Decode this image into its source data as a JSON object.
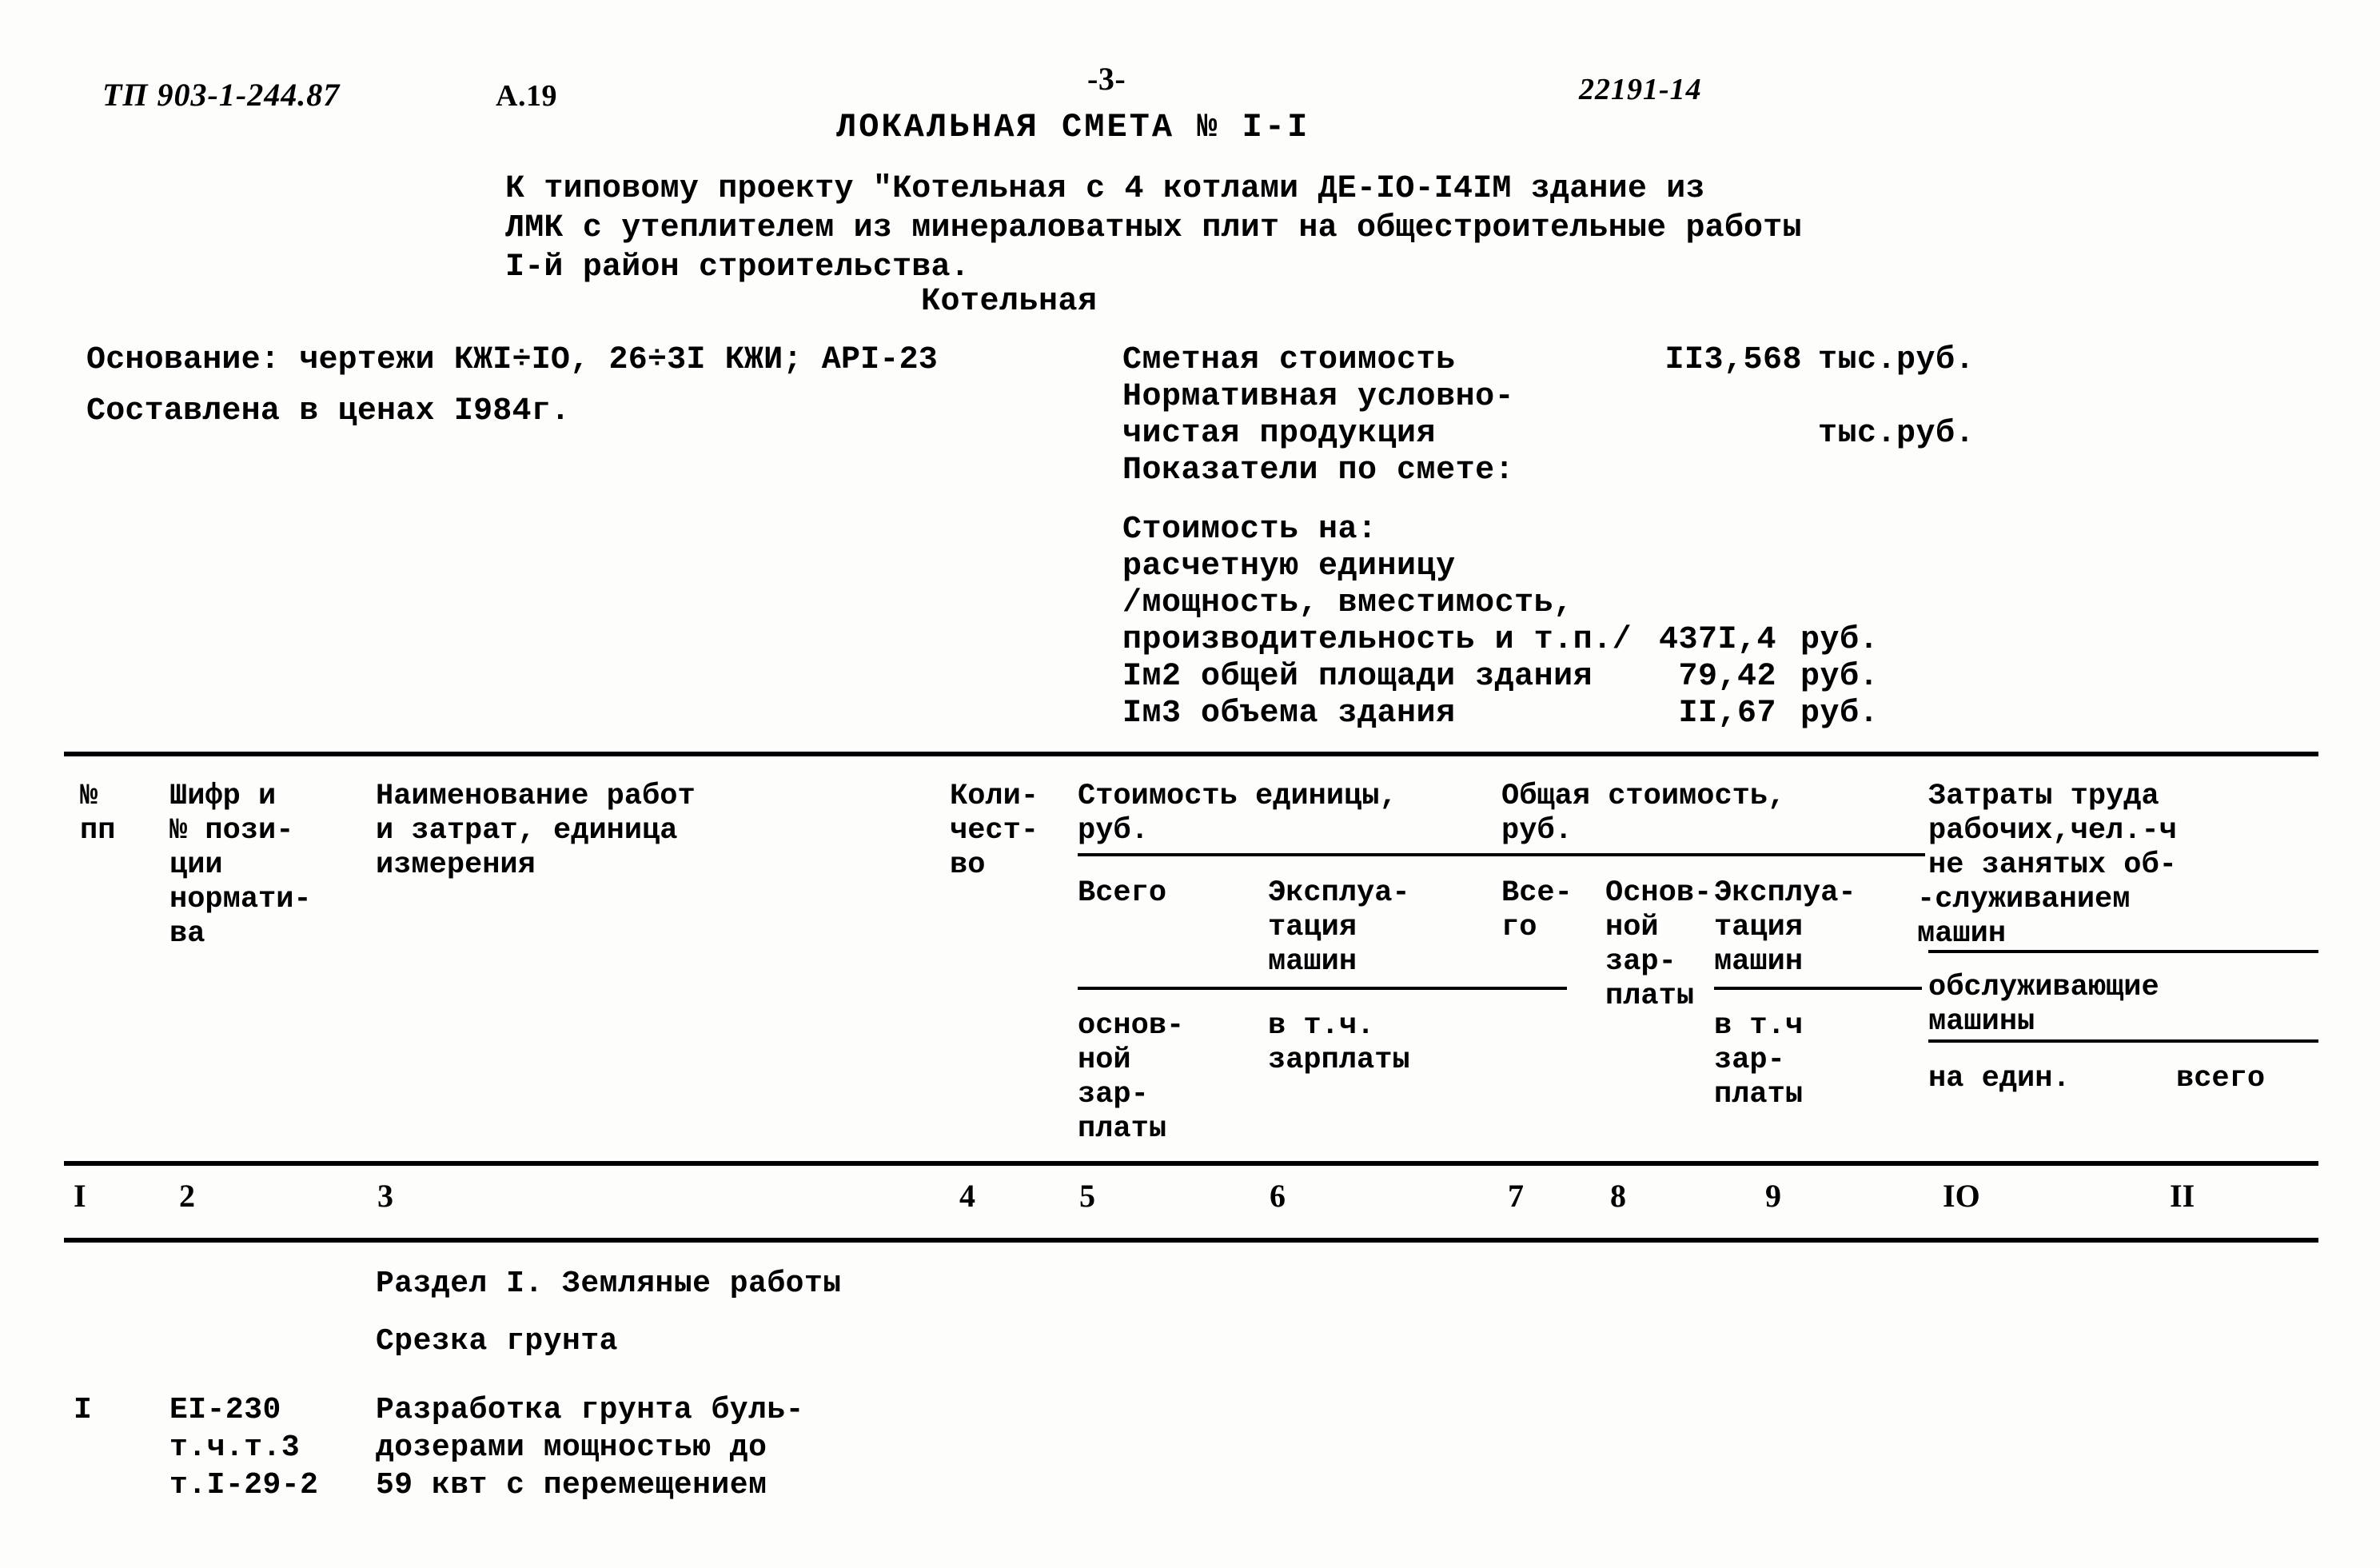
{
  "header": {
    "doc_code": "ТП 903-1-244.87",
    "sheet_code": "А.19",
    "page_number": "-3-",
    "archive_code": "22191-14",
    "title": "ЛОКАЛЬНАЯ СМЕТА № I-I"
  },
  "project": {
    "description_line1": "К типовому проекту \"Котельная с 4 котлами ДЕ-IO-I4IM здание из",
    "description_line2": "ЛМК с утеплителем из минераловатных плит на общестроительные работы",
    "description_line3": "I-й район строительства.",
    "object_name": "Котельная"
  },
  "basis": {
    "basis_line": "Основание: чертежи КЖI÷IO, 26÷3I КЖИ; АPI-23",
    "prices_line": "Составлена в ценах I984г."
  },
  "summary": {
    "estimate_cost_label": "Сметная стоимость",
    "estimate_cost_value": "II3,568",
    "estimate_cost_unit": "тыс.руб.",
    "net_output_label_line1": "Нормативная условно-",
    "net_output_label_line2": "чистая продукция",
    "net_output_value": "",
    "net_output_unit": "тыс.руб.",
    "indicators_label": "Показатели по смете:"
  },
  "indicators": {
    "cost_on_label": "Стоимость на:",
    "rows": [
      {
        "label": "расчетную единицу",
        "value": "",
        "unit": ""
      },
      {
        "label": "/мощность, вместимость,",
        "value": "",
        "unit": ""
      },
      {
        "label": "производительность и т.п./",
        "value": "437I,4",
        "unit": "руб."
      },
      {
        "label": "Iм2 общей площади здания",
        "value": "79,42",
        "unit": "руб."
      },
      {
        "label": "Iм3 объема здания",
        "value": "II,67",
        "unit": "руб."
      }
    ]
  },
  "table": {
    "headers": {
      "col1_line1": "№",
      "col1_line2": "пп",
      "col2": "Шифр и\n№ пози-\nции\nнормати-\nва",
      "col3": "Наименование работ\nи затрат, единица\nизмерения",
      "col4": "Коли-\nчест-\nво",
      "unit_cost_group": "Стоимость единицы,\nруб.",
      "unit_cost_total": "Всего",
      "unit_cost_machines": "Эксплуа-\nтация\nмашин",
      "unit_cost_total_sub": "основ-\nной\nзар-\nплаты",
      "unit_cost_machines_sub": "в т.ч.\nзарплаты",
      "total_cost_group": "Общая стоимость,\nруб.",
      "total_cost_all": "Все-\nго",
      "total_cost_basic": "Основ-\nной\nзар-\nплаты",
      "total_cost_machines": "Эксплуа-\nтация\nмашин",
      "total_cost_machines_sub": "в т.ч\nзар-\nплаты",
      "labor_group_line1": "Затраты труда",
      "labor_group_line2": "рабочих,чел.-ч",
      "labor_group_line3": "не занятых об-",
      "labor_group_line4": "-служиванием",
      "labor_group_line5": "машин",
      "labor_servicing_line1": "обслуживающие",
      "labor_servicing_line2": "машины",
      "labor_per_unit": "на един.",
      "labor_total": "всего"
    },
    "column_numbers": [
      "I",
      "2",
      "3",
      "4",
      "5",
      "6",
      "7",
      "8",
      "9",
      "IO",
      "II"
    ],
    "section_title": "Раздел I. Земляные работы",
    "subsection_title": "Срезка грунта",
    "rows": [
      {
        "num": "I",
        "code_line1": "ЕI-230",
        "code_line2": "т.ч.т.3",
        "code_line3": "т.I-29-2",
        "name_line1": "Разработка грунта буль-",
        "name_line2": "дозерами мощностью до",
        "name_line3": "59 квт с перемещением",
        "quantity": "",
        "unit_cost_total": "",
        "unit_cost_machines": "",
        "total_all": "",
        "total_basic": "",
        "total_machines": "",
        "labor_per_unit": "",
        "labor_total": ""
      }
    ]
  }
}
